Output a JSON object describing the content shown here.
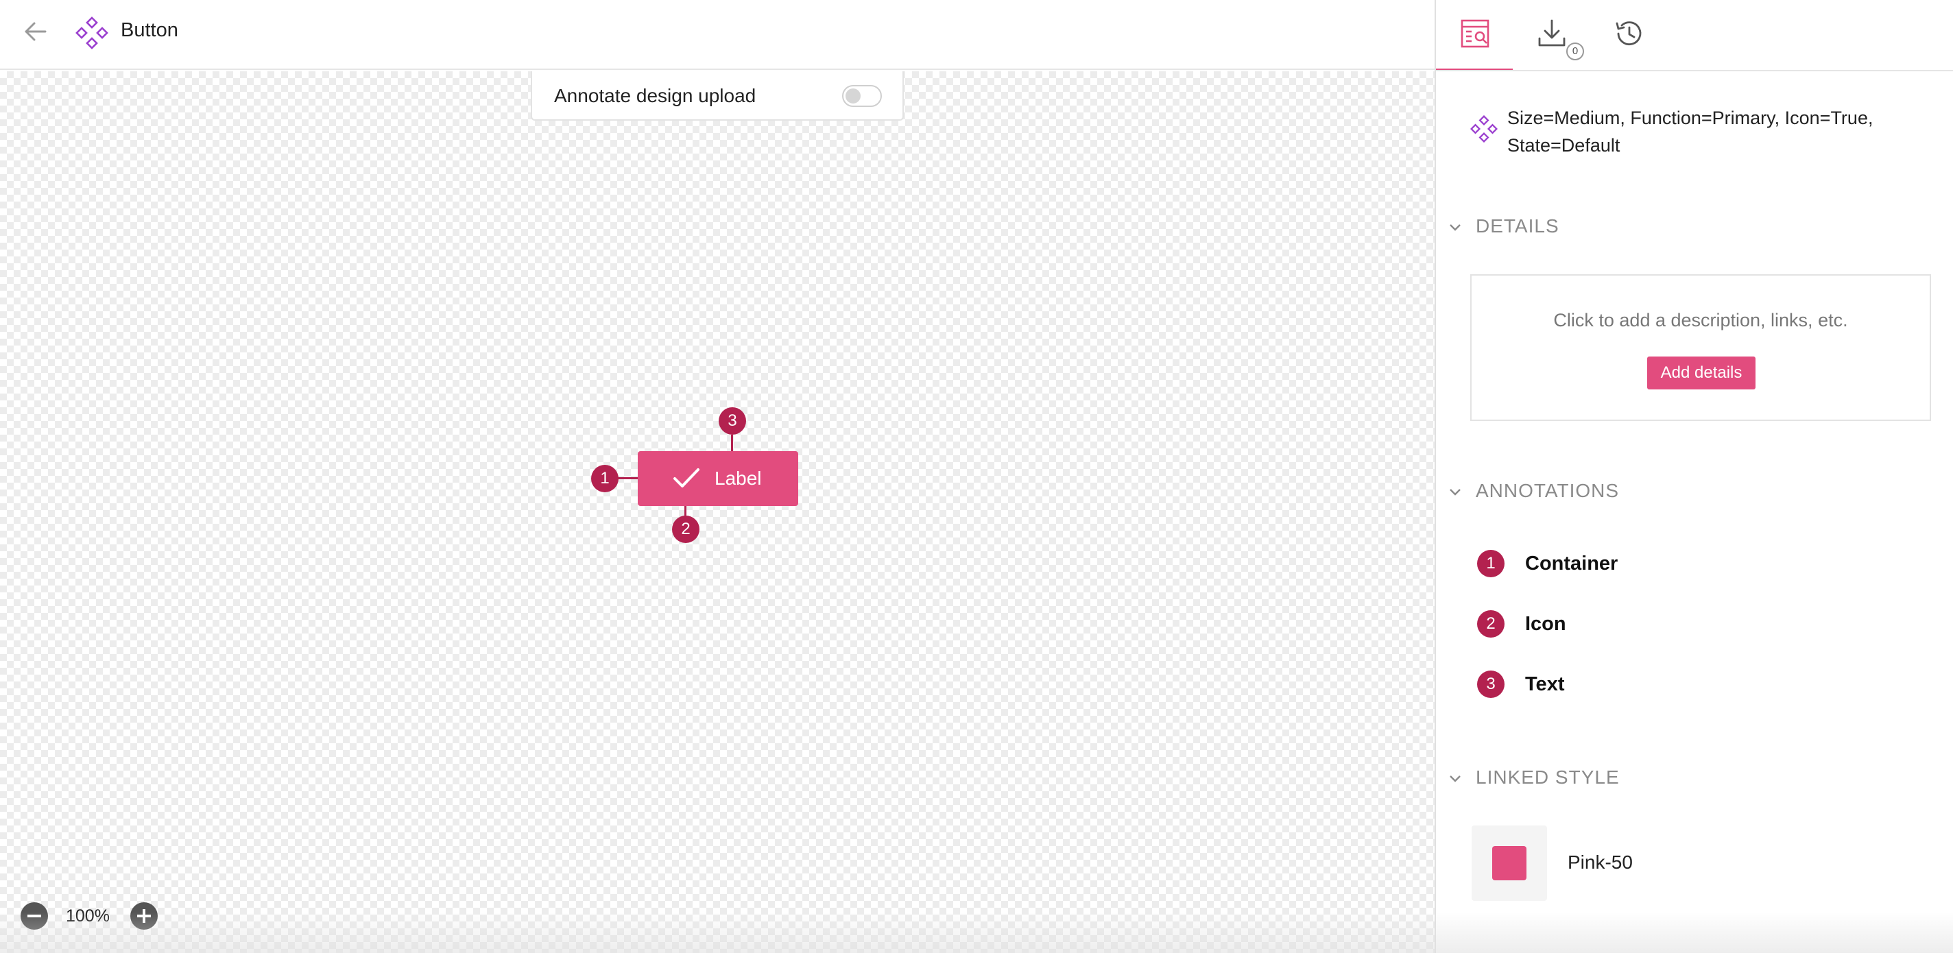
{
  "header": {
    "title": "Button",
    "back_icon": "arrow-left-icon",
    "component_icon": "component-diamond-icon"
  },
  "canvas": {
    "annotate_toggle_label": "Annotate design upload",
    "annotate_toggle_on": false,
    "component": {
      "label": "Label",
      "icon": "checkmark-icon",
      "color": "#e24c7e"
    },
    "markers": [
      "1",
      "2",
      "3"
    ],
    "marker_color": "#b3214f",
    "zoom": {
      "level": "100%",
      "zoom_out_icon": "minus-circle-icon",
      "zoom_in_icon": "plus-circle-icon"
    }
  },
  "sidebar": {
    "tabs": [
      {
        "name": "inspect",
        "icon": "inspect-icon",
        "active": true
      },
      {
        "name": "download",
        "icon": "download-icon",
        "badge": "0"
      },
      {
        "name": "history",
        "icon": "history-icon"
      }
    ],
    "variant_name": "Size=Medium, Function=Primary, Icon=True, State=Default",
    "details": {
      "header": "DETAILS",
      "hint": "Click to add a description, links, etc.",
      "button": "Add details"
    },
    "annotations": {
      "header": "ANNOTATIONS",
      "items": [
        {
          "num": "1",
          "label": "Container"
        },
        {
          "num": "2",
          "label": "Icon"
        },
        {
          "num": "3",
          "label": "Text"
        }
      ]
    },
    "linked_style": {
      "header": "LINKED STYLE",
      "name": "Pink-50",
      "color": "#e24c7e"
    },
    "accent_color": "#e24c7e"
  }
}
